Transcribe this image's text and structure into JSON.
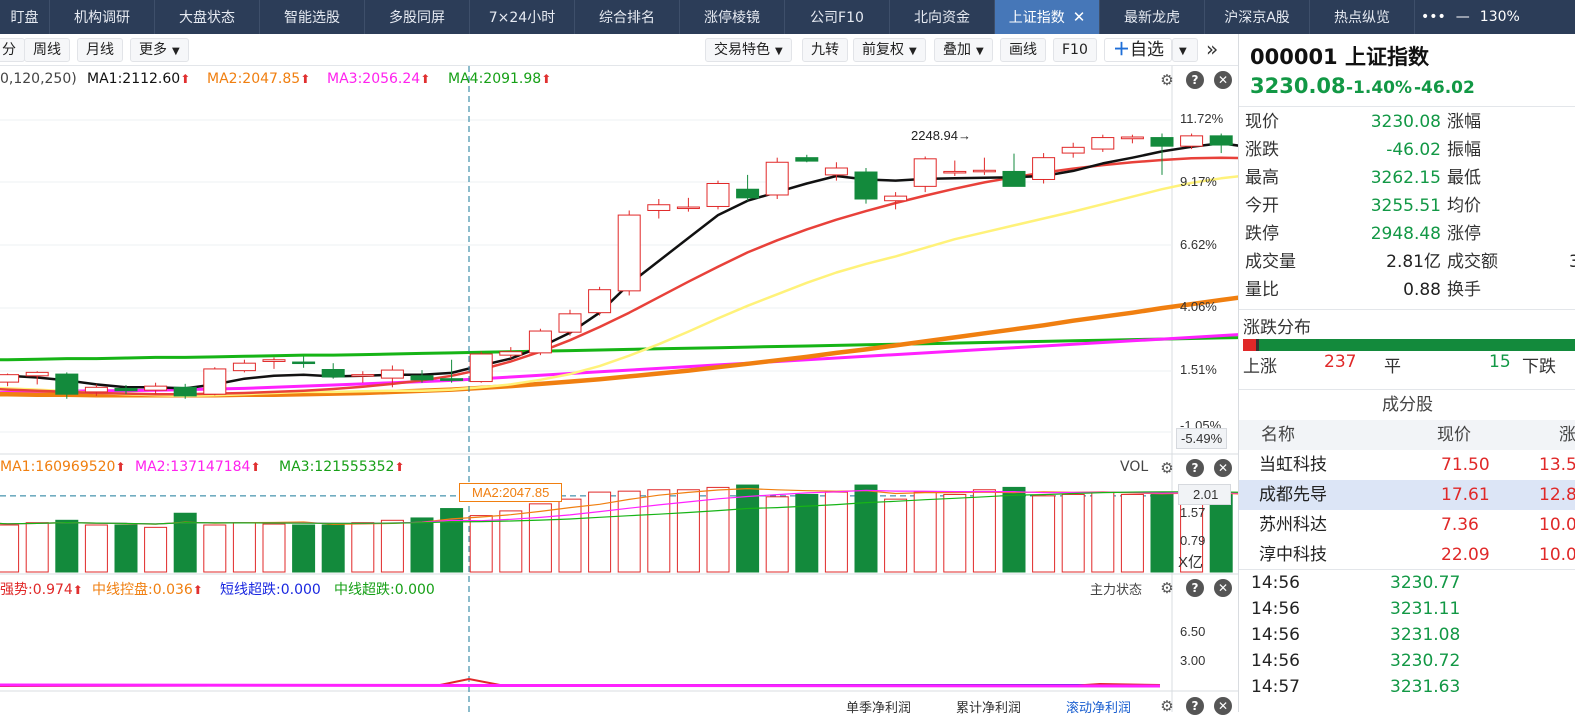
{
  "tabs": [
    {
      "label": "盯盘",
      "active": false
    },
    {
      "label": "机构调研",
      "active": false
    },
    {
      "label": "大盘状态",
      "active": false
    },
    {
      "label": "智能选股",
      "active": false
    },
    {
      "label": "多股同屏",
      "active": false
    },
    {
      "label": "7×24小时",
      "active": false
    },
    {
      "label": "综合排名",
      "active": false
    },
    {
      "label": "涨停棱镜",
      "active": false
    },
    {
      "label": "公司F10",
      "active": false
    },
    {
      "label": "北向资金",
      "active": false
    },
    {
      "label": "上证指数",
      "active": true
    },
    {
      "label": "最新龙虎",
      "active": false
    },
    {
      "label": "沪深京A股",
      "active": false
    },
    {
      "label": "热点纵览",
      "active": false
    }
  ],
  "window": {
    "more": "•••",
    "minimize": "—",
    "zoom": "130%"
  },
  "toolbar_left": [
    "分",
    "周线",
    "月线",
    "更多"
  ],
  "toolbar_right": [
    "交易特色",
    "九转",
    "前复权",
    "叠加",
    "画线",
    "F10",
    "自选"
  ],
  "main_indicators": {
    "prefix": "0,120,250)",
    "ma1": "MA1:2112.60",
    "ma2": "MA2:2047.85",
    "ma3": "MA3:2056.24",
    "ma4": "MA4:2091.98"
  },
  "price_axis": [
    "11.72%",
    "9.17%",
    "6.62%",
    "4.06%",
    "1.51%",
    "-1.05%"
  ],
  "crosshair_label": "-5.49%",
  "peak_label": "2248.94→",
  "volume": {
    "ma1": "MA1:160969520",
    "ma2": "MA2:137147184",
    "ma3": "MA3:121555352",
    "title": "VOL",
    "axis": [
      "1.57",
      "0.79"
    ],
    "unit": "X亿",
    "cursor_value": "2.01",
    "tooltip": "MA2:2047.85"
  },
  "third_panel": {
    "i1": "强势:0.974",
    "i2": "中线控盘:0.036",
    "i3": "短线超跌:0.000",
    "i4": "中线超跌:0.000",
    "title": "主力状态",
    "axis": [
      "6.50",
      "3.00"
    ],
    "bottom_tabs": [
      "单季净利润",
      "累计净利润",
      "滚动净利润"
    ]
  },
  "colors": {
    "up": "#e02828",
    "down": "#138a3c",
    "ma1": "#111111",
    "ma2": "#f07f10",
    "ma3": "#ff33ff",
    "ma4": "#17b417",
    "tab_active": "#4677b8"
  },
  "quote": {
    "code": "000001",
    "name": "上证指数",
    "price": "3230.08",
    "change_pct": "-1.40%",
    "change": "-46.02",
    "rows": [
      {
        "l": "现价",
        "v": "3230.08",
        "r": "涨幅"
      },
      {
        "l": "涨跌",
        "v": "-46.02",
        "r": "振幅"
      },
      {
        "l": "最高",
        "v": "3262.15",
        "r": "最低"
      },
      {
        "l": "今开",
        "v": "3255.51",
        "r": "均价"
      },
      {
        "l": "跌停",
        "v": "2948.48",
        "r": "涨停"
      },
      {
        "l": "成交量",
        "v": "2.81亿",
        "r": "成交额",
        "extra": "3"
      },
      {
        "l": "量比",
        "v": "0.88",
        "r": "换手"
      }
    ]
  },
  "distribution": {
    "title": "涨跌分布",
    "up_label": "上涨",
    "up": "237",
    "flat_label": "平",
    "flat": "15",
    "down_label": "下跌",
    "up_ratio": 0.048
  },
  "components": {
    "title": "成分股",
    "headers": [
      "名称",
      "现价",
      "涨"
    ],
    "rows": [
      {
        "name": "当虹科技",
        "price": "71.50",
        "chg": "13.5"
      },
      {
        "name": "成都先导",
        "price": "17.61",
        "chg": "12.8"
      },
      {
        "name": "苏州科达",
        "price": "7.36",
        "chg": "10.0"
      },
      {
        "name": "淳中科技",
        "price": "22.09",
        "chg": "10.0"
      }
    ]
  },
  "ticks": [
    {
      "time": "14:56",
      "price": "3230.77"
    },
    {
      "time": "14:56",
      "price": "3231.11"
    },
    {
      "time": "14:56",
      "price": "3231.08"
    },
    {
      "time": "14:56",
      "price": "3230.72"
    },
    {
      "time": "14:57",
      "price": "3231.63"
    }
  ],
  "candles": [
    {
      "o": 2090,
      "h": 2098,
      "l": 2070,
      "c": 2080
    },
    {
      "o": 2079,
      "h": 2094,
      "l": 2072,
      "c": 2092
    },
    {
      "o": 2090,
      "h": 2098,
      "l": 2075,
      "c": 2096
    },
    {
      "o": 2093,
      "h": 2096,
      "l": 2050,
      "c": 2058
    },
    {
      "o": 2062,
      "h": 2075,
      "l": 2055,
      "c": 2070
    },
    {
      "o": 2068,
      "h": 2074,
      "l": 2058,
      "c": 2064
    },
    {
      "o": 2065,
      "h": 2078,
      "l": 2058,
      "c": 2072
    },
    {
      "o": 2070,
      "h": 2076,
      "l": 2050,
      "c": 2055
    },
    {
      "o": 2058,
      "h": 2105,
      "l": 2056,
      "c": 2102
    },
    {
      "o": 2099,
      "h": 2118,
      "l": 2096,
      "c": 2112
    },
    {
      "o": 2115,
      "h": 2122,
      "l": 2102,
      "c": 2118
    },
    {
      "o": 2114,
      "h": 2124,
      "l": 2104,
      "c": 2112
    },
    {
      "o": 2101,
      "h": 2112,
      "l": 2085,
      "c": 2088
    },
    {
      "o": 2090,
      "h": 2098,
      "l": 2078,
      "c": 2092
    },
    {
      "o": 2086,
      "h": 2108,
      "l": 2070,
      "c": 2100
    },
    {
      "o": 2090,
      "h": 2100,
      "l": 2078,
      "c": 2083
    },
    {
      "o": 2085,
      "h": 2118,
      "l": 2078,
      "c": 2082
    },
    {
      "o": 2080,
      "h": 2132,
      "l": 2078,
      "c": 2128
    },
    {
      "o": 2126,
      "h": 2140,
      "l": 2120,
      "c": 2132
    },
    {
      "o": 2130,
      "h": 2172,
      "l": 2126,
      "c": 2168
    },
    {
      "o": 2166,
      "h": 2205,
      "l": 2160,
      "c": 2198
    },
    {
      "o": 2200,
      "h": 2245,
      "l": 2195,
      "c": 2240
    },
    {
      "o": 2238,
      "h": 2378,
      "l": 2230,
      "c": 2370
    },
    {
      "o": 2378,
      "h": 2398,
      "l": 2364,
      "c": 2388
    },
    {
      "o": 2382,
      "h": 2400,
      "l": 2376,
      "c": 2384
    },
    {
      "o": 2385,
      "h": 2430,
      "l": 2380,
      "c": 2425
    },
    {
      "o": 2415,
      "h": 2440,
      "l": 2395,
      "c": 2400
    },
    {
      "o": 2405,
      "h": 2470,
      "l": 2398,
      "c": 2462
    },
    {
      "o": 2470,
      "h": 2475,
      "l": 2462,
      "c": 2464
    },
    {
      "o": 2440,
      "h": 2462,
      "l": 2430,
      "c": 2452
    },
    {
      "o": 2445,
      "h": 2452,
      "l": 2390,
      "c": 2398
    },
    {
      "o": 2395,
      "h": 2410,
      "l": 2380,
      "c": 2403
    },
    {
      "o": 2420,
      "h": 2472,
      "l": 2410,
      "c": 2468
    },
    {
      "o": 2445,
      "h": 2465,
      "l": 2438,
      "c": 2446
    },
    {
      "o": 2446,
      "h": 2470,
      "l": 2440,
      "c": 2448
    },
    {
      "o": 2446,
      "h": 2477,
      "l": 2420,
      "c": 2420
    },
    {
      "o": 2432,
      "h": 2478,
      "l": 2425,
      "c": 2470
    },
    {
      "o": 2478,
      "h": 2496,
      "l": 2470,
      "c": 2488
    },
    {
      "o": 2485,
      "h": 2510,
      "l": 2480,
      "c": 2505
    },
    {
      "o": 2503,
      "h": 2510,
      "l": 2495,
      "c": 2506
    },
    {
      "o": 2505,
      "h": 2512,
      "l": 2440,
      "c": 2490
    },
    {
      "o": 2490,
      "h": 2512,
      "l": 2485,
      "c": 2508
    },
    {
      "o": 2508,
      "h": 2512,
      "l": 2478,
      "c": 2492
    },
    {
      "o": 2472,
      "h": 2490,
      "l": 2425,
      "c": 2442
    },
    {
      "o": 2440,
      "h": 2450,
      "l": 2430,
      "c": 2446
    },
    {
      "o": 2455,
      "h": 2460,
      "l": 2405,
      "c": 2410
    }
  ],
  "ma_series": {
    "ma1": [
      2090,
      2090,
      2087,
      2082,
      2075,
      2070,
      2070,
      2068,
      2075,
      2085,
      2090,
      2092,
      2089,
      2090,
      2092,
      2092,
      2095,
      2108,
      2120,
      2140,
      2165,
      2200,
      2250,
      2290,
      2330,
      2370,
      2395,
      2410,
      2425,
      2438,
      2432,
      2430,
      2433,
      2434,
      2435,
      2436,
      2438,
      2447,
      2460,
      2470,
      2481,
      2489,
      2495,
      2488,
      2475,
      2465
    ],
    "ma2": [
      2070,
      2068,
      2066,
      2063,
      2060,
      2058,
      2056,
      2055,
      2056,
      2058,
      2060,
      2062,
      2062,
      2063,
      2064,
      2064,
      2066,
      2070,
      2075,
      2083,
      2093,
      2107,
      2125,
      2145,
      2167,
      2190,
      2212,
      2232,
      2252,
      2270,
      2285,
      2298,
      2313,
      2328,
      2340,
      2352,
      2364,
      2376,
      2389,
      2402,
      2415,
      2426,
      2434,
      2440,
      2446,
      2448
    ],
    "ma3": [
      2060,
      2061,
      2062,
      2063,
      2064,
      2064,
      2065,
      2066,
      2067,
      2068,
      2070,
      2072,
      2074,
      2076,
      2078,
      2080,
      2082,
      2085,
      2088,
      2091,
      2094,
      2097,
      2100,
      2103,
      2106,
      2109,
      2112,
      2115,
      2118,
      2121,
      2124,
      2127,
      2130,
      2133,
      2136,
      2139,
      2142,
      2145,
      2148,
      2151,
      2154,
      2157,
      2160,
      2163,
      2166,
      2170
    ],
    "ma4": [
      2118,
      2118,
      2119,
      2120,
      2120,
      2121,
      2122,
      2122,
      2123,
      2124,
      2125,
      2126,
      2126,
      2127,
      2128,
      2129,
      2130,
      2131,
      2132,
      2133,
      2134,
      2135,
      2136,
      2137,
      2138,
      2139,
      2140,
      2141,
      2142,
      2143,
      2144,
      2145,
      2146,
      2147,
      2148,
      2149,
      2150,
      2151,
      2152,
      2153,
      2154,
      2155,
      2156,
      2157,
      2158,
      2160
    ],
    "ma5": [
      2058,
      2058,
      2057,
      2057,
      2056,
      2056,
      2056,
      2056,
      2056,
      2057,
      2057,
      2058,
      2059,
      2060,
      2062,
      2064,
      2066,
      2069,
      2072,
      2076,
      2080,
      2084,
      2089,
      2094,
      2099,
      2105,
      2111,
      2117,
      2123,
      2130,
      2136,
      2143,
      2150,
      2157,
      2164,
      2171,
      2178,
      2186,
      2193,
      2200,
      2208,
      2215,
      2222,
      2229,
      2236,
      2244
    ],
    "ma6": [
      2068,
      2066,
      2064,
      2062,
      2060,
      2059,
      2058,
      2058,
      2059,
      2060,
      2062,
      2064,
      2067,
      2071,
      2076,
      2082,
      2090,
      2101,
      2115,
      2132,
      2152,
      2175,
      2200,
      2227,
      2254,
      2280,
      2305,
      2326,
      2345,
      2362,
      2377,
      2391,
      2404,
      2416,
      2427,
      2436,
      2444,
      2451,
      2457,
      2462,
      2466,
      2469,
      2470,
      2469,
      2467,
      2465
    ]
  },
  "volumes": [
    1.05,
    1.0,
    1.05,
    1.1,
    1.0,
    1.0,
    0.95,
    1.25,
    1.0,
    1.05,
    1.02,
    1.0,
    1.0,
    1.05,
    1.1,
    1.15,
    1.35,
    1.2,
    1.3,
    1.45,
    1.55,
    1.7,
    1.72,
    1.75,
    1.75,
    1.8,
    1.85,
    1.6,
    1.65,
    1.7,
    1.85,
    1.55,
    1.7,
    1.65,
    1.75,
    1.8,
    1.62,
    1.65,
    1.7,
    1.65,
    1.7,
    1.68,
    1.66,
    1.55,
    1.4,
    1.48
  ]
}
